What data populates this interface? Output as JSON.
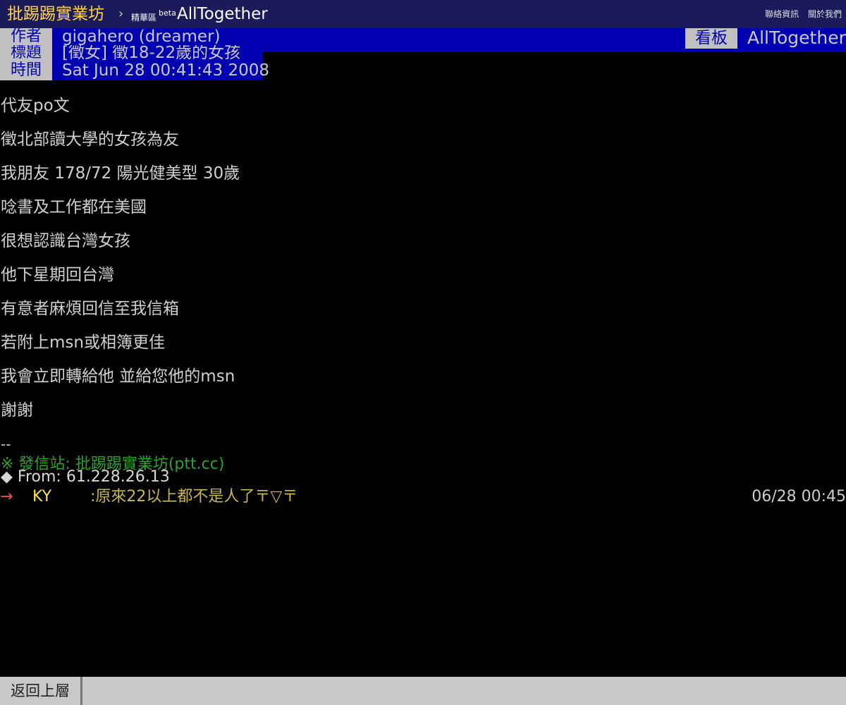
{
  "topbar": {
    "site_name": "批踢踢實業坊",
    "separator": "›",
    "section": "精華區",
    "beta": "beta",
    "board": "AllTogether",
    "links": [
      "聯絡資訊",
      "關於我們"
    ]
  },
  "meta": {
    "author_label": "作者",
    "author": "gigahero (dreamer)",
    "title_label": "標題",
    "title": "[徵女] 徵18-22歲的女孩",
    "time_label": "時間",
    "time": "Sat Jun 28 00:41:43 2008",
    "board_label": "看板",
    "board": "AllTogether"
  },
  "body_lines": [
    "代友po文",
    "徵北部讀大學的女孩為友",
    "我朋友 178/72 陽光健美型 30歲",
    "唸書及工作都在美國",
    "很想認識台灣女孩",
    "他下星期回台灣",
    "有意者麻煩回信至我信箱",
    "若附上msn或相簿更佳",
    "我會立即轉給他 並給您他的msn",
    "謝謝"
  ],
  "signature": {
    "separator": "--",
    "site": "※ 發信站: 批踢踢實業坊(ptt.cc)",
    "from": "◆ From: 61.228.26.13"
  },
  "push": {
    "tag": "→",
    "user": "KY",
    "content": ":原來22以上都不是人了〒▽〒",
    "time": "06/28 00:45"
  },
  "bottombar": {
    "back_label": "返回上層"
  },
  "colors": {
    "topbar_bg": "#1b1b5c",
    "meta_bg": "#0000b0",
    "site_name": "#ffd24a",
    "signature_green": "#2aa52a",
    "push_user": "#ffe14d"
  }
}
